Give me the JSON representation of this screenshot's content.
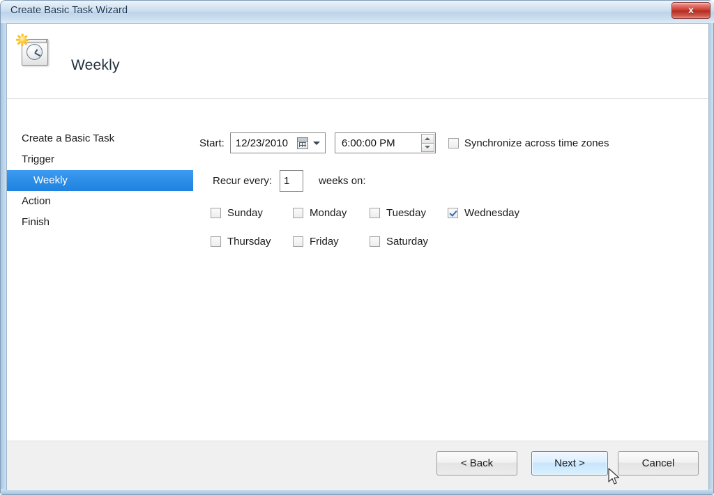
{
  "window": {
    "title": "Create Basic Task Wizard",
    "close_label": "x",
    "close_icon": "close-icon"
  },
  "header": {
    "title": "Weekly",
    "icon": "calendar-clock-icon"
  },
  "sidebar": {
    "items": [
      {
        "label": "Create a Basic Task",
        "selected": false,
        "sub": false
      },
      {
        "label": "Trigger",
        "selected": false,
        "sub": false
      },
      {
        "label": "Weekly",
        "selected": true,
        "sub": true
      },
      {
        "label": "Action",
        "selected": false,
        "sub": false
      },
      {
        "label": "Finish",
        "selected": false,
        "sub": false
      }
    ],
    "selected_color": "#2d8ee8"
  },
  "main": {
    "start_label": "Start:",
    "start_date": "12/23/2010",
    "start_time": "6:00:00 PM",
    "date_picker_icon": "calendar-icon",
    "date_dropdown_icon": "chevron-down-icon",
    "time_spinner_up_icon": "spinner-up-icon",
    "time_spinner_down_icon": "spinner-down-icon",
    "sync_label": "Synchronize across time zones",
    "sync_checked": false,
    "recur_label": "Recur every:",
    "recur_value": "1",
    "weeks_label": "weeks on:",
    "days": [
      {
        "label": "Sunday",
        "checked": false
      },
      {
        "label": "Monday",
        "checked": false
      },
      {
        "label": "Tuesday",
        "checked": false
      },
      {
        "label": "Wednesday",
        "checked": true
      },
      {
        "label": "Thursday",
        "checked": false
      },
      {
        "label": "Friday",
        "checked": false
      },
      {
        "label": "Saturday",
        "checked": false
      }
    ]
  },
  "footer": {
    "back_label": "< Back",
    "next_label": "Next >",
    "cancel_label": "Cancel",
    "next_highlight_color": "#c7e5fb"
  },
  "cursor": {
    "icon": "mouse-pointer-icon"
  }
}
